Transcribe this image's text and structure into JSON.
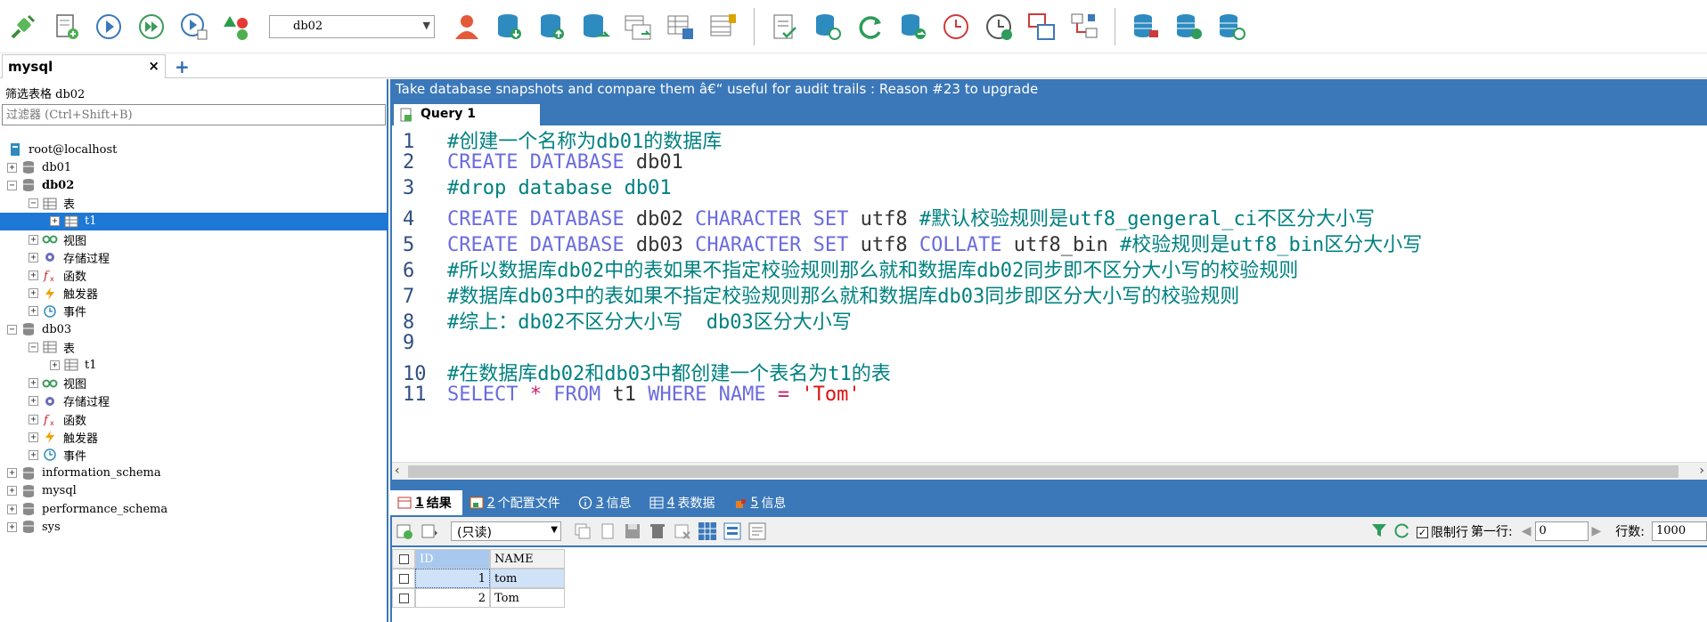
{
  "toolbar": {
    "database_select": "db02",
    "icons": [
      "plug-icon",
      "new-query-icon",
      "run-icon",
      "run-all-icon",
      "run-explain-icon",
      "shapes-icon",
      "user-icon",
      "db-import-icon",
      "db-export-icon",
      "db-sync-icon",
      "schema-compare-icon",
      "data-compare-icon",
      "query-builder-icon",
      "query-log-icon",
      "backup-icon",
      "refresh-icon",
      "restore-icon",
      "scheduler-icon",
      "play-scheduler-icon",
      "designer-icon",
      "diagram-icon",
      "db-stack-1-icon",
      "db-stack-2-icon",
      "db-stack-3-icon"
    ]
  },
  "connection_tab": {
    "label": "mysql",
    "close": "×",
    "add": "+"
  },
  "left": {
    "filter_label": "筛选表格 db02",
    "filter_placeholder": "过滤器 (Ctrl+Shift+B)",
    "tree": [
      {
        "label": "root@localhost",
        "type": "server",
        "depth": 0,
        "expander": ""
      },
      {
        "label": "db01",
        "type": "database",
        "depth": 0,
        "expander": "+"
      },
      {
        "label": "db02",
        "type": "database",
        "depth": 0,
        "expander": "−",
        "bold": true
      },
      {
        "label": "表",
        "type": "tables",
        "depth": 1,
        "expander": "−"
      },
      {
        "label": "t1",
        "type": "table",
        "depth": 2,
        "expander": "+",
        "selected": true
      },
      {
        "label": "视图",
        "type": "views",
        "depth": 1,
        "expander": "+"
      },
      {
        "label": "存储过程",
        "type": "procedures",
        "depth": 1,
        "expander": "+"
      },
      {
        "label": "函数",
        "type": "functions",
        "depth": 1,
        "expander": "+"
      },
      {
        "label": "触发器",
        "type": "triggers",
        "depth": 1,
        "expander": "+"
      },
      {
        "label": "事件",
        "type": "events",
        "depth": 1,
        "expander": "+"
      },
      {
        "label": "db03",
        "type": "database",
        "depth": 0,
        "expander": "−"
      },
      {
        "label": "表",
        "type": "tables",
        "depth": 1,
        "expander": "−"
      },
      {
        "label": "t1",
        "type": "table",
        "depth": 2,
        "expander": "+"
      },
      {
        "label": "视图",
        "type": "views",
        "depth": 1,
        "expander": "+"
      },
      {
        "label": "存储过程",
        "type": "procedures",
        "depth": 1,
        "expander": "+"
      },
      {
        "label": "函数",
        "type": "functions",
        "depth": 1,
        "expander": "+"
      },
      {
        "label": "触发器",
        "type": "triggers",
        "depth": 1,
        "expander": "+"
      },
      {
        "label": "事件",
        "type": "events",
        "depth": 1,
        "expander": "+"
      },
      {
        "label": "information_schema",
        "type": "database",
        "depth": 0,
        "expander": "+"
      },
      {
        "label": "mysql",
        "type": "database",
        "depth": 0,
        "expander": "+"
      },
      {
        "label": "performance_schema",
        "type": "database",
        "depth": 0,
        "expander": "+"
      },
      {
        "label": "sys",
        "type": "database",
        "depth": 0,
        "expander": "+"
      }
    ]
  },
  "banner": "Take database snapshots and compare them â€“ useful for audit trails : Reason #23 to upgrade",
  "query_tab": {
    "label": "Query 1",
    "add": "+"
  },
  "editor": {
    "lines": [
      {
        "n": "1",
        "tokens": [
          [
            "c",
            "#创建一个名称为db01的数据库"
          ]
        ]
      },
      {
        "n": "2",
        "tokens": [
          [
            "k",
            "CREATE DATABASE "
          ],
          [
            "p",
            "db01"
          ]
        ]
      },
      {
        "n": "3",
        "tokens": [
          [
            "c",
            "#drop database db01"
          ]
        ]
      },
      {
        "n": "4",
        "tokens": [
          [
            "k",
            "CREATE DATABASE "
          ],
          [
            "p",
            "db02 "
          ],
          [
            "k",
            "CHARACTER SET "
          ],
          [
            "p",
            "utf8 "
          ],
          [
            "c",
            "#默认校验规则是utf8_gengeral_ci不区分大小写"
          ]
        ]
      },
      {
        "n": "5",
        "tokens": [
          [
            "k",
            "CREATE DATABASE "
          ],
          [
            "p",
            "db03 "
          ],
          [
            "k",
            "CHARACTER SET "
          ],
          [
            "p",
            "utf8 "
          ],
          [
            "k",
            "COLLATE "
          ],
          [
            "p",
            "utf8_bin "
          ],
          [
            "c",
            "#校验规则是utf8_bin区分大小写"
          ]
        ]
      },
      {
        "n": "6",
        "tokens": [
          [
            "c",
            "#所以数据库db02中的表如果不指定校验规则那么就和数据库db02同步即不区分大小写的校验规则"
          ]
        ]
      },
      {
        "n": "7",
        "tokens": [
          [
            "c",
            "#数据库db03中的表如果不指定校验规则那么就和数据库db03同步即区分大小写的校验规则"
          ]
        ]
      },
      {
        "n": "8",
        "tokens": [
          [
            "c",
            "#综上：db02不区分大小写  db03区分大小写"
          ]
        ]
      },
      {
        "n": "9",
        "tokens": []
      },
      {
        "n": "10",
        "tokens": [
          [
            "c",
            "#在数据库db02和db03中都创建一个表名为t1的表"
          ]
        ]
      },
      {
        "n": "11",
        "tokens": [
          [
            "k",
            "SELECT "
          ],
          [
            "o",
            "* "
          ],
          [
            "k",
            "FROM "
          ],
          [
            "p",
            "t1 "
          ],
          [
            "k",
            "WHERE NAME "
          ],
          [
            "o",
            "= "
          ],
          [
            "s",
            "'Tom'"
          ]
        ]
      }
    ]
  },
  "result_tabs": [
    {
      "num": "1",
      "label": "结果",
      "active": true
    },
    {
      "num": "2",
      "label": "个配置文件",
      "active": false
    },
    {
      "num": "3",
      "label": "信息",
      "active": false
    },
    {
      "num": "4",
      "label": "表数据",
      "active": false
    },
    {
      "num": "5",
      "label": "信息",
      "active": false
    }
  ],
  "result_toolbar": {
    "readonly_select": "(只读)",
    "limit_label": "限制行",
    "first_row_label": "第一行:",
    "first_row_value": "0",
    "rows_label": "行数:",
    "rows_value": "1000"
  },
  "grid": {
    "columns": [
      "ID",
      "NAME"
    ],
    "rows": [
      {
        "id": "1",
        "name": "tom"
      },
      {
        "id": "2",
        "name": "Tom"
      }
    ]
  },
  "colors": {
    "accent_blue": "#3b78b9",
    "selection": "#1e78d6",
    "comment": "#008080",
    "keyword": "#6b6bdf",
    "string": "#dd1111"
  }
}
